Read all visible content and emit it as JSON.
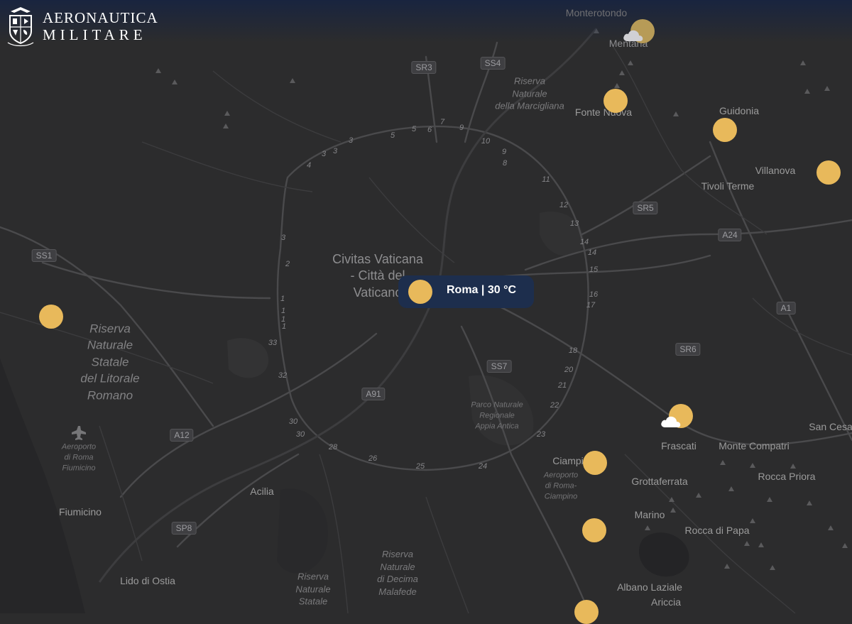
{
  "logo": {
    "line1": "Aeronautica",
    "line2": "Militare",
    "emblem_icon": "aeronautica-militare-crest-icon"
  },
  "colors": {
    "map_background": "#2c2c2d",
    "sun_marker": "#e8b95b",
    "tooltip_background": "#1d2e4d",
    "tooltip_text": "#ffffff",
    "header_fade": "#182440"
  },
  "tooltip": {
    "city": "Roma",
    "separator": "|",
    "temperature": "30 °C",
    "label": "Roma | 30 °C"
  },
  "places": {
    "monterotondo": "Monterotondo",
    "mentana": "Mentana",
    "fonte_nuova": "Fonte Nuova",
    "guidonia": "Guidonia",
    "villanova": "Villanova",
    "tivoli_terme": "Tivoli Terme",
    "frascati": "Frascati",
    "monte_compatri": "Monte Compatri",
    "san_cesareo": "San Cesa",
    "rocca_priora": "Rocca Priora",
    "grottaferrata": "Grottaferrata",
    "ciampino": "Ciampi",
    "marino": "Marino",
    "rocca_di_papa": "Rocca di Papa",
    "albano_laziale": "Albano Laziale",
    "ariccia": "Ariccia",
    "acilia": "Acilia",
    "fiumicino": "Fiumicino",
    "lido_di_ostia": "Lido di Ostia"
  },
  "vatican": {
    "line1": "Civitas Vaticana",
    "line2": "- Città del",
    "line3": "Vaticano"
  },
  "areas": {
    "marcigliana": [
      "Riserva",
      "Naturale",
      "della Marcigliana"
    ],
    "litorale": [
      "Riserva",
      "Naturale",
      "Statale",
      "del Litorale",
      "Romano"
    ],
    "appia": [
      "Parco Naturale",
      "Regionale",
      "Appia Antica"
    ],
    "airport_ciampino": [
      "Aeroporto",
      "di Roma-",
      "Ciampino"
    ],
    "airport_fiumicino": [
      "Aeroporto",
      "di Roma",
      "Fiumicino"
    ],
    "decima": [
      "Riserva",
      "Naturale",
      "di Decima",
      "Malafede"
    ],
    "statale_south": [
      "Riserva",
      "Naturale",
      "Statale"
    ]
  },
  "roads": [
    "SR3",
    "SS4",
    "SR5",
    "A24",
    "A1",
    "SR6",
    "SS7",
    "A91",
    "A12",
    "SP8",
    "SS1"
  ],
  "junctions": [
    "3",
    "3",
    "4",
    "5",
    "5",
    "6",
    "7",
    "9",
    "10",
    "9",
    "8",
    "11",
    "12",
    "13",
    "14",
    "14",
    "15",
    "16",
    "17",
    "18",
    "20",
    "21",
    "22",
    "23",
    "24",
    "25",
    "26",
    "28",
    "30",
    "30",
    "32",
    "33",
    "1",
    "1",
    "1",
    "1",
    "2",
    "3",
    "3"
  ],
  "markers": [
    {
      "name": "marker-mentana",
      "weather": "partly-cloudy"
    },
    {
      "name": "marker-fonte-nuova",
      "weather": "sunny"
    },
    {
      "name": "marker-guidonia",
      "weather": "sunny"
    },
    {
      "name": "marker-tivoli",
      "weather": "sunny"
    },
    {
      "name": "marker-roma",
      "weather": "sunny"
    },
    {
      "name": "marker-fiumicino-coast",
      "weather": "sunny"
    },
    {
      "name": "marker-frascati",
      "weather": "partly-cloudy"
    },
    {
      "name": "marker-ciampino",
      "weather": "sunny"
    },
    {
      "name": "marker-marino",
      "weather": "sunny"
    },
    {
      "name": "marker-albano",
      "weather": "sunny"
    }
  ]
}
